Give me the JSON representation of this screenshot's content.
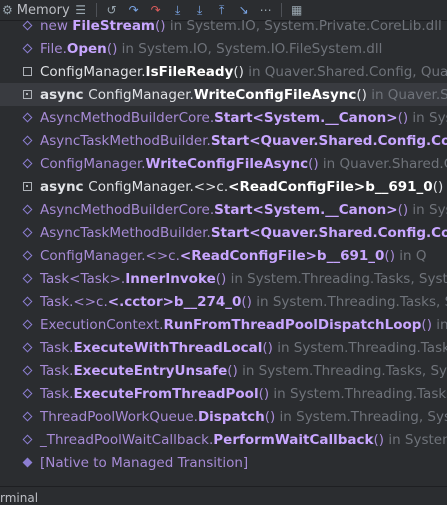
{
  "toolbar": {
    "memory_label": "Memory",
    "icons": [
      "list-icon",
      "return-icon",
      "step-over-icon",
      "step-out-red-icon",
      "step-into-icon",
      "force-step-into-icon",
      "run-to-cursor-icon",
      "evaluate-icon",
      "filter-icon",
      "table-icon"
    ]
  },
  "frames": [
    {
      "kind": "ext",
      "prefix": "new ",
      "method": "FileStream",
      "suffix": "()",
      "loc": " in System.IO, System.Private.CoreLib.dll"
    },
    {
      "kind": "ext",
      "prefix": "File.",
      "method": "Open",
      "suffix": "()",
      "loc": " in System.IO, System.IO.FileSystem.dll"
    },
    {
      "kind": "user",
      "prefix": "ConfigManager.",
      "method": "IsFileReady",
      "suffix": "()",
      "loc": " in Quaver.Shared.Config, Qua"
    },
    {
      "kind": "user-async",
      "async": "async ",
      "prefix": "ConfigManager.",
      "method": "WriteConfigFileAsync",
      "suffix": "()",
      "loc": " in Quaver.Sh"
    },
    {
      "kind": "ext",
      "prefix": "AsyncMethodBuilderCore.",
      "method": "Start<System.__Canon>",
      "suffix": "()",
      "loc": " in Sys"
    },
    {
      "kind": "ext",
      "prefix": "AsyncTaskMethodBuilder.",
      "method": "Start<Quaver.Shared.Config.Con",
      "suffix": "",
      "loc": ""
    },
    {
      "kind": "ext",
      "prefix": "ConfigManager.",
      "method": "WriteConfigFileAsync",
      "suffix": "()",
      "loc": " in Quaver.Shared.C"
    },
    {
      "kind": "user-async",
      "async": "async ",
      "prefix": "ConfigManager.<>c.",
      "method": "<ReadConfigFile>b__691_0",
      "suffix": "()",
      "loc": " in Q"
    },
    {
      "kind": "ext",
      "prefix": "AsyncMethodBuilderCore.",
      "method": "Start<System.__Canon>",
      "suffix": "()",
      "loc": " in Sys"
    },
    {
      "kind": "ext",
      "prefix": "AsyncTaskMethodBuilder.",
      "method": "Start<Quaver.Shared.Config.Con",
      "suffix": "",
      "loc": ""
    },
    {
      "kind": "ext",
      "prefix": "ConfigManager.<>c.",
      "method": "<ReadConfigFile>b__691_0",
      "suffix": "()",
      "loc": " in Q"
    },
    {
      "kind": "ext",
      "prefix": "Task<Task>.",
      "method": "InnerInvoke",
      "suffix": "()",
      "loc": " in System.Threading.Tasks, System"
    },
    {
      "kind": "ext",
      "prefix": "Task.<>c.",
      "method": "<.cctor>b__274_0",
      "suffix": "()",
      "loc": " in System.Threading.Tasks, Sys"
    },
    {
      "kind": "ext",
      "prefix": "ExecutionContext.",
      "method": "RunFromThreadPoolDispatchLoop",
      "suffix": "()",
      "loc": " in Sys"
    },
    {
      "kind": "ext",
      "prefix": "Task.",
      "method": "ExecuteWithThreadLocal",
      "suffix": "()",
      "loc": " in System.Threading.Tasks,"
    },
    {
      "kind": "ext",
      "prefix": "Task.",
      "method": "ExecuteEntryUnsafe",
      "suffix": "()",
      "loc": " in System.Threading.Tasks, Sys"
    },
    {
      "kind": "ext",
      "prefix": "Task.",
      "method": "ExecuteFromThreadPool",
      "suffix": "()",
      "loc": " in System.Threading.Tasks,"
    },
    {
      "kind": "ext",
      "prefix": "ThreadPoolWorkQueue.",
      "method": "Dispatch",
      "suffix": "()",
      "loc": " in System.Threading, Sys"
    },
    {
      "kind": "ext",
      "prefix": "_ThreadPoolWaitCallback.",
      "method": "PerformWaitCallback",
      "suffix": "()",
      "loc": " in System"
    },
    {
      "kind": "native",
      "prefix": "[Native to Managed Transition]",
      "method": "",
      "suffix": "",
      "loc": ""
    }
  ],
  "selected_index": 3,
  "bottom": {
    "label": "rminal"
  }
}
